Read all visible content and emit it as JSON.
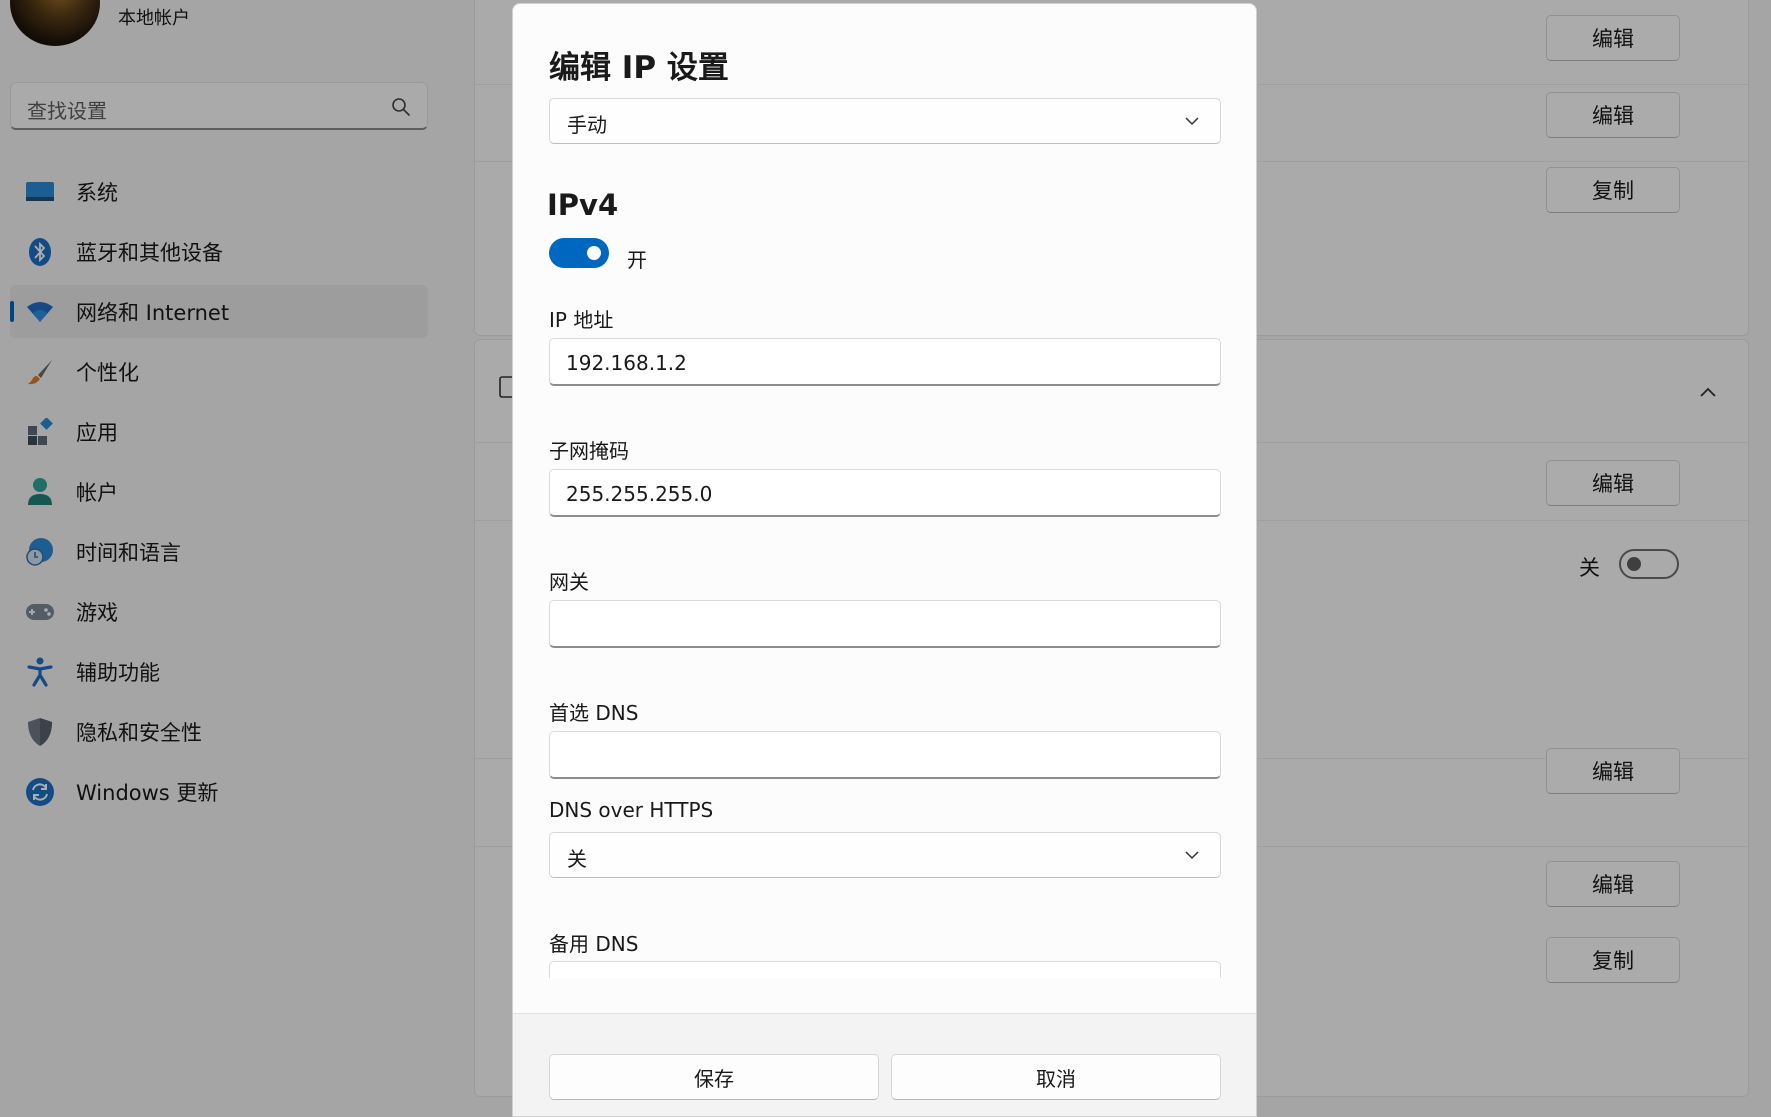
{
  "account": {
    "name": "本地帐户"
  },
  "search": {
    "placeholder": "查找设置",
    "icon": "search-icon"
  },
  "sidebar": {
    "items": [
      {
        "label": "系统",
        "icon": "system-icon",
        "active": false
      },
      {
        "label": "蓝牙和其他设备",
        "icon": "bluetooth-icon",
        "active": false
      },
      {
        "label": "网络和 Internet",
        "icon": "wifi-icon",
        "active": true
      },
      {
        "label": "个性化",
        "icon": "brush-icon",
        "active": false
      },
      {
        "label": "应用",
        "icon": "apps-icon",
        "active": false
      },
      {
        "label": "帐户",
        "icon": "person-icon",
        "active": false
      },
      {
        "label": "时间和语言",
        "icon": "globe-clock-icon",
        "active": false
      },
      {
        "label": "游戏",
        "icon": "gamepad-icon",
        "active": false
      },
      {
        "label": "辅助功能",
        "icon": "accessibility-icon",
        "active": false
      },
      {
        "label": "隐私和安全性",
        "icon": "shield-icon",
        "active": false
      },
      {
        "label": "Windows 更新",
        "icon": "update-icon",
        "active": false
      }
    ]
  },
  "background": {
    "buttons": {
      "edit": "编辑",
      "copy": "复制"
    },
    "toggle_off_label": "关"
  },
  "dialog": {
    "title": "编辑 IP 设置",
    "mode": "手动",
    "section": "IPv4",
    "ipv4_toggle": {
      "state": "开",
      "on": true
    },
    "fields": {
      "ip_address": {
        "label": "IP 地址",
        "value": "192.168.1.2"
      },
      "subnet_mask": {
        "label": "子网掩码",
        "value": "255.255.255.0"
      },
      "gateway": {
        "label": "网关",
        "value": ""
      },
      "preferred_dns": {
        "label": "首选 DNS",
        "value": ""
      },
      "dns_over_https": {
        "label": "DNS over HTTPS",
        "value": "关"
      },
      "alternate_dns": {
        "label": "备用 DNS",
        "value": ""
      }
    },
    "buttons": {
      "save": "保存",
      "cancel": "取消"
    }
  },
  "colors": {
    "accent": "#0067c0",
    "overlay": "rgba(0,0,0,0.32)"
  }
}
